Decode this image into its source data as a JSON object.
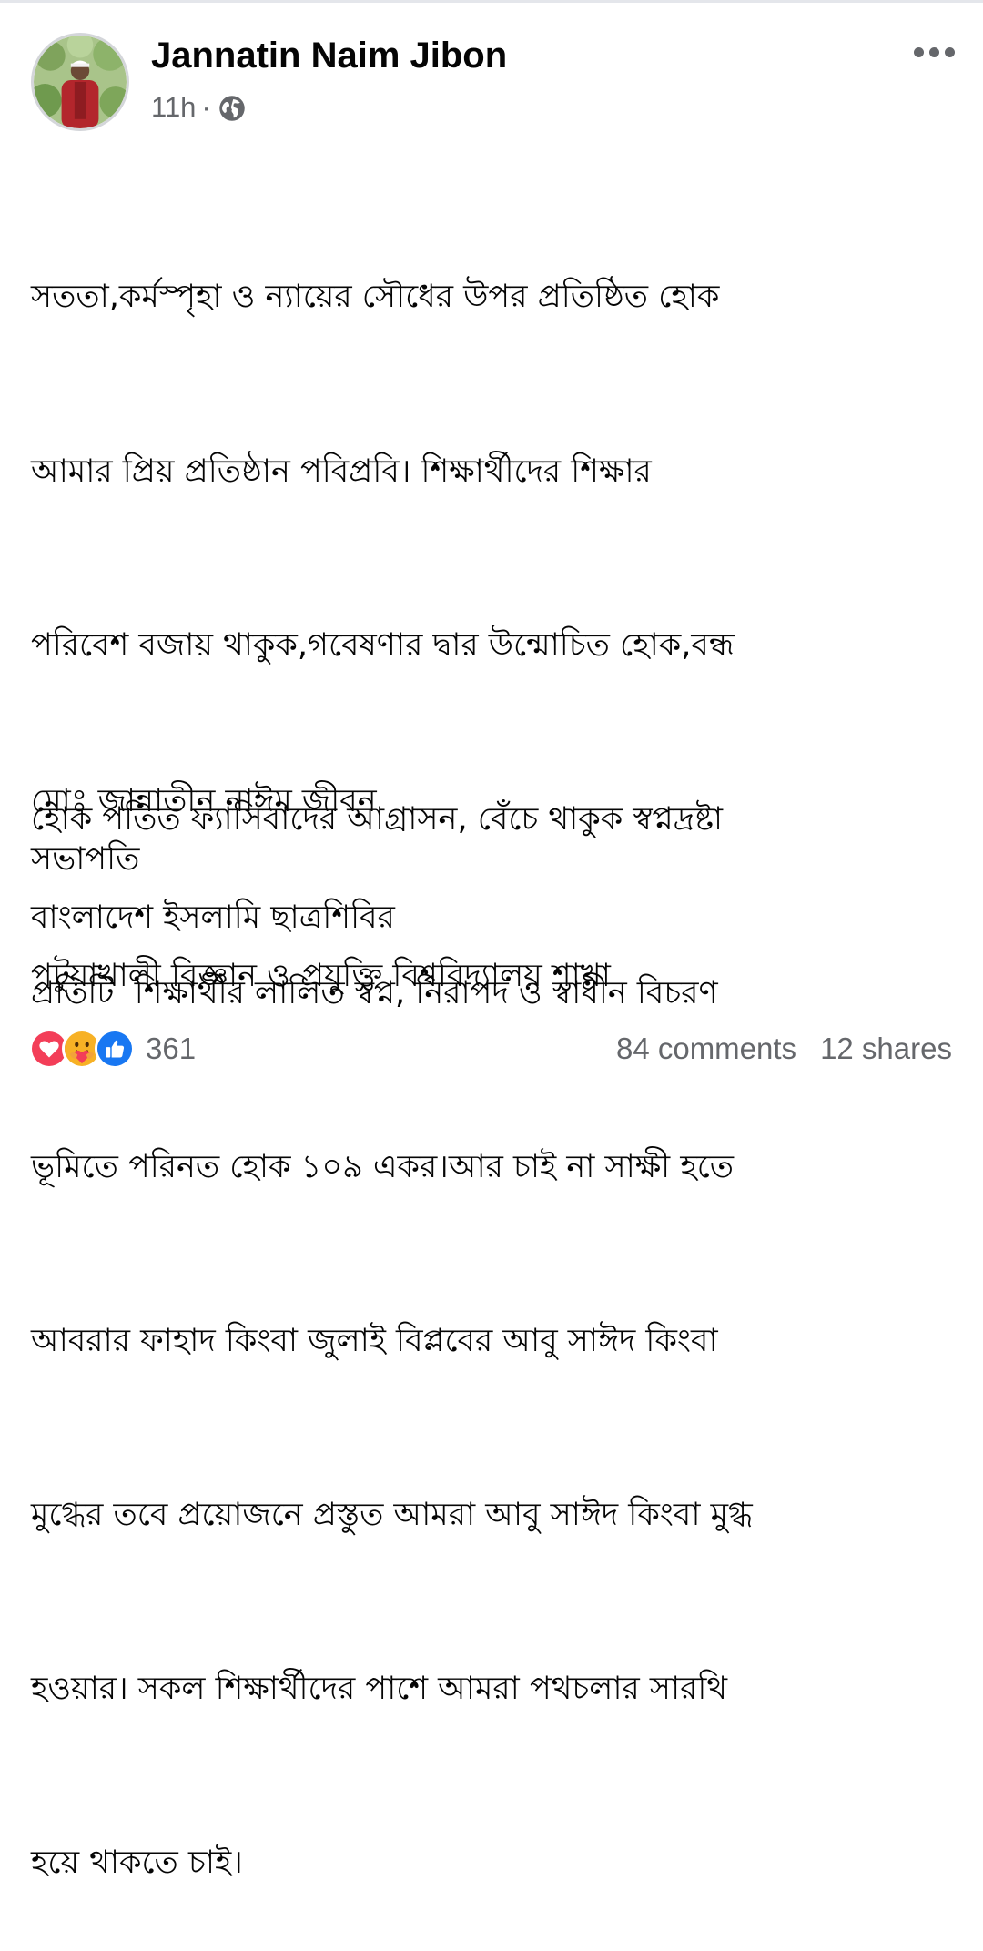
{
  "post": {
    "author": "Jannatin Naim Jibon",
    "time": "11h",
    "separator": "·",
    "privacy_icon": "globe-icon",
    "body_lines": [
      "সততা,কর্মস্পৃহা ও ন্যায়ের সৌধের উপর প্রতিষ্ঠিত হোক",
      "আমার প্রিয় প্রতিষ্ঠান পবিপ্রবি। শিক্ষার্থীদের শিক্ষার",
      "পরিবেশ বজায় থাকুক,গবেষণার দ্বার উন্মোচিত হোক,বন্ধ",
      "হোক পতিত ফ্যাসিবাদের আগ্রাসন, বেঁচে থাকুক স্বপ্নদ্রষ্টা",
      "প্রতিটি  শিক্ষার্থীর লালিত স্বপ্ন, নিরাপদ ও স্বাধীন বিচরণ",
      "ভূমিতে পরিনত হোক ১০৯ একর।আর চাই না সাক্ষী হতে",
      "আবরার ফাহাদ কিংবা জুলাই বিপ্লবের আবু সাঈদ কিংবা",
      "মুগ্ধের তবে প্রয়োজনে প্রস্তুত আমরা আবু সাঈদ কিংবা মুগ্ধ",
      "হওয়ার। সকল শিক্ষার্থীদের পাশে আমরা পথচলার সারথি",
      "হয়ে থাকতে চাই।"
    ],
    "signature": {
      "name": "মোঃ জান্নাতীন নাঈম জীবন",
      "title": "সভাপতি",
      "organization": "বাংলাদেশ ইসলামি ছাত্রশিবির",
      "branch": "পটুয়াখালী বিজ্ঞান ও প্রযুক্তি বিশ্ববিদ্যালয় শাখা"
    }
  },
  "footer": {
    "reaction_icons": [
      "love-icon",
      "care-icon",
      "like-icon"
    ],
    "reaction_count": "361",
    "comments": "84 comments",
    "shares": "12 shares"
  },
  "colors": {
    "text": "#050505",
    "secondary_text": "#65676b",
    "like_blue": "#1877f2",
    "love_red": "#f33e58",
    "care_yellow": "#f7b125"
  },
  "more_menu_icon": "more-horizontal-icon"
}
